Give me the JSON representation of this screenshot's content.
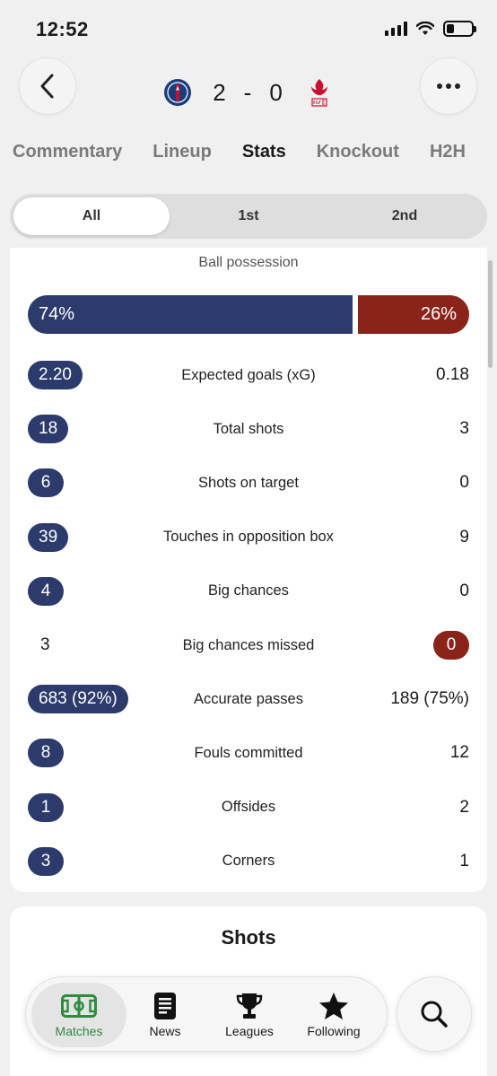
{
  "status_bar": {
    "time": "12:52",
    "battery_level": 0.3
  },
  "match": {
    "home_team": "PSG",
    "away_team": "Liverpool",
    "home_score": "2",
    "separator": "-",
    "away_score": "0"
  },
  "tabs": [
    {
      "label": "Commentary",
      "active": false
    },
    {
      "label": "Lineup",
      "active": false
    },
    {
      "label": "Stats",
      "active": true
    },
    {
      "label": "Knockout",
      "active": false
    },
    {
      "label": "H2H",
      "active": false
    }
  ],
  "period_filter": [
    {
      "label": "All",
      "active": true
    },
    {
      "label": "1st",
      "active": false
    },
    {
      "label": "2nd",
      "active": false
    }
  ],
  "possession": {
    "label": "Ball possession",
    "home": "74%",
    "away": "26%",
    "home_fraction": 0.74
  },
  "stats": [
    {
      "label": "Expected goals (xG)",
      "home": "2.20",
      "away": "0.18",
      "leader": "home"
    },
    {
      "label": "Total shots",
      "home": "18",
      "away": "3",
      "leader": "home"
    },
    {
      "label": "Shots on target",
      "home": "6",
      "away": "0",
      "leader": "home"
    },
    {
      "label": "Touches in opposition box",
      "home": "39",
      "away": "9",
      "leader": "home"
    },
    {
      "label": "Big chances",
      "home": "4",
      "away": "0",
      "leader": "home"
    },
    {
      "label": "Big chances missed",
      "home": "3",
      "away": "0",
      "leader": "away"
    },
    {
      "label": "Accurate passes",
      "home": "683 (92%)",
      "away": "189 (75%)",
      "leader": "home"
    },
    {
      "label": "Fouls committed",
      "home": "8",
      "away": "12",
      "leader": "home"
    },
    {
      "label": "Offsides",
      "home": "1",
      "away": "2",
      "leader": "home"
    },
    {
      "label": "Corners",
      "home": "3",
      "away": "1",
      "leader": "home"
    }
  ],
  "shots_section": {
    "title": "Shots"
  },
  "bottom_nav": [
    {
      "label": "Matches",
      "icon": "pitch-icon",
      "active": true
    },
    {
      "label": "News",
      "icon": "news-icon",
      "active": false
    },
    {
      "label": "Leagues",
      "icon": "trophy-icon",
      "active": false
    },
    {
      "label": "Following",
      "icon": "star-icon",
      "active": false
    }
  ],
  "colors": {
    "home": "#2c3b6c",
    "away": "#8a2319",
    "active_nav": "#2e8b3f"
  }
}
